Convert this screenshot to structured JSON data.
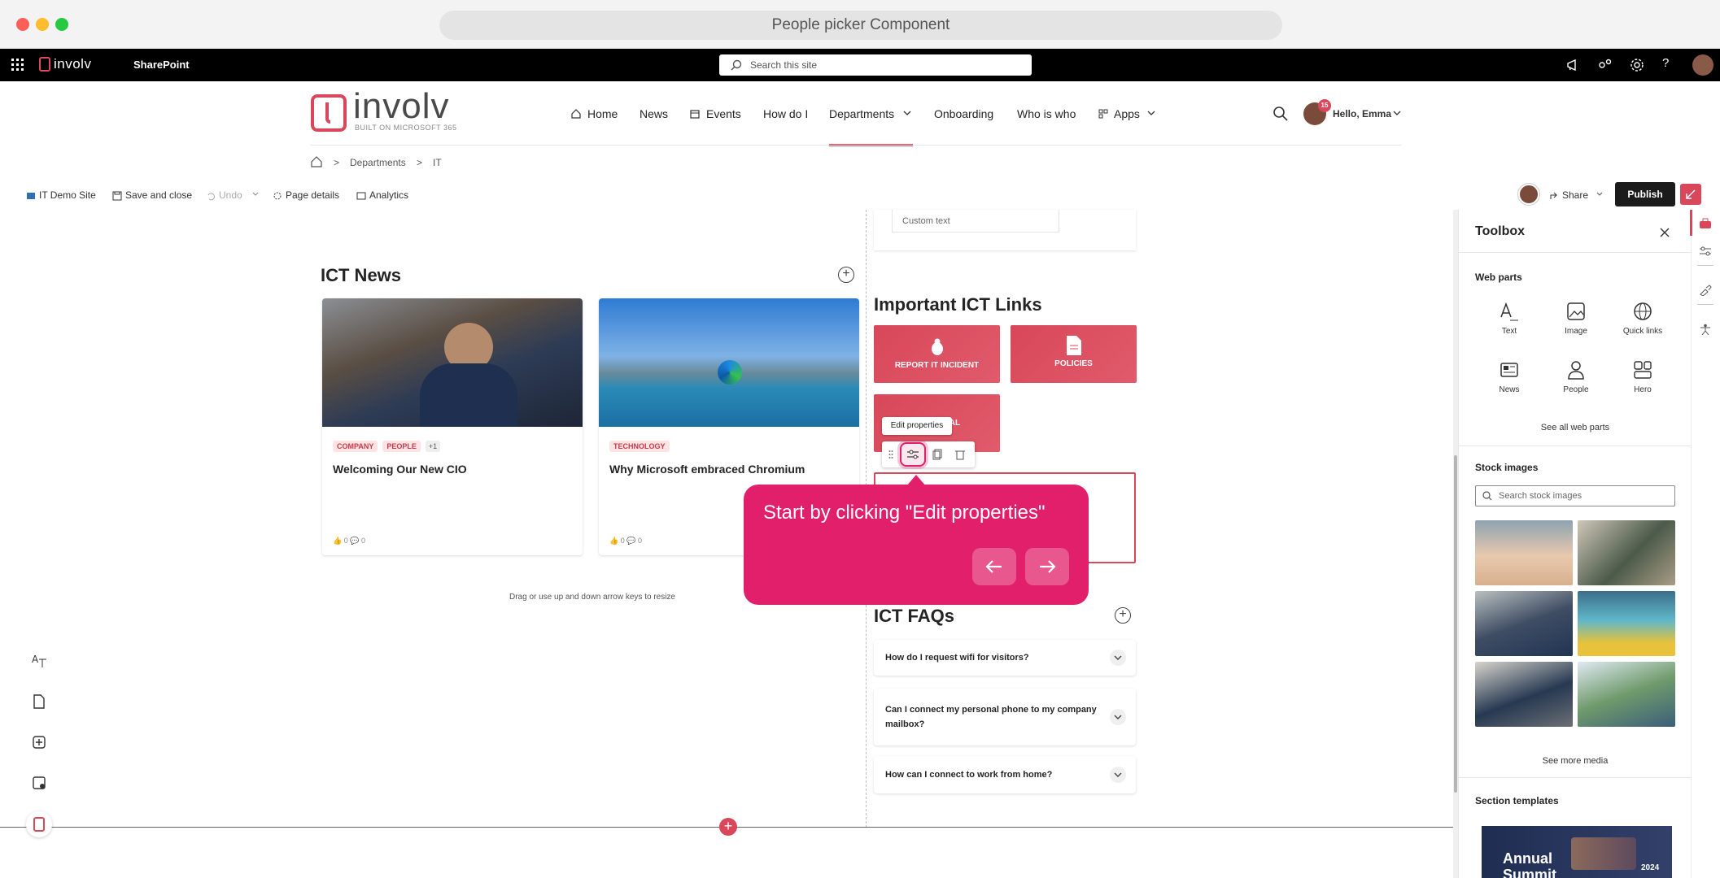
{
  "browser": {
    "title": "People picker Component"
  },
  "suite": {
    "app_name": "SharePoint",
    "search_placeholder": "Search this site"
  },
  "brand": {
    "logo_text": "involv",
    "logo_sub": "BUILT ON MICROSOFT 365"
  },
  "nav": {
    "items": [
      "Home",
      "News",
      "Events",
      "How do I",
      "Departments",
      "Onboarding",
      "Who is who",
      "Apps"
    ],
    "active": "Departments",
    "greeting": "Hello, Emma",
    "badge": "15"
  },
  "breadcrumb": {
    "items": [
      "Departments",
      "IT"
    ]
  },
  "toolbar": {
    "site": "IT Demo Site",
    "save": "Save and close",
    "undo": "Undo",
    "page_details": "Page details",
    "analytics": "Analytics",
    "share": "Share",
    "publish": "Publish"
  },
  "news": {
    "title": "ICT News",
    "cards": [
      {
        "tags": [
          "COMPANY",
          "PEOPLE"
        ],
        "more": "+1",
        "title": "Welcoming Our New CIO",
        "likes": "0",
        "comments": "0"
      },
      {
        "tags": [
          "TECHNOLOGY"
        ],
        "title": "Why Microsoft embraced Chromium",
        "likes": "0",
        "comments": "0"
      }
    ],
    "resize_hint": "Drag or use up and down arrow keys to resize"
  },
  "links": {
    "custom_text": "Custom text",
    "title": "Important ICT Links",
    "tiles": [
      "REPORT IT INCIDENT",
      "POLICIES",
      "TERIAL"
    ],
    "tooltip": "Edit properties"
  },
  "tour": {
    "message": "Start by clicking \"Edit properties\""
  },
  "faqs": {
    "title": "ICT FAQs",
    "items": [
      "How do I request wifi for visitors?",
      "Can I connect my personal phone to my company mailbox?",
      "How can I connect to work from home?"
    ]
  },
  "toolbox": {
    "title": "Toolbox",
    "webparts_heading": "Web parts",
    "webparts": [
      "Text",
      "Image",
      "Quick links",
      "News",
      "People",
      "Hero"
    ],
    "see_all": "See all web parts",
    "stock_heading": "Stock images",
    "stock_placeholder": "Search stock images",
    "see_more": "See more media",
    "templates_heading": "Section templates",
    "template_text": "Annual Summit",
    "template_year": "2024"
  }
}
